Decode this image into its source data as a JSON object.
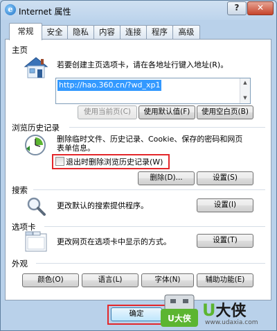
{
  "window": {
    "title": "Internet 属性",
    "help_label": "?",
    "close_label": "✕",
    "app_icon_letter": "e"
  },
  "tabs": [
    {
      "label": "常规",
      "active": true
    },
    {
      "label": "安全"
    },
    {
      "label": "隐私"
    },
    {
      "label": "内容"
    },
    {
      "label": "连接"
    },
    {
      "label": "程序"
    },
    {
      "label": "高级"
    }
  ],
  "homepage": {
    "section_label": "主页",
    "description": "若要创建主页选项卡，请在各地址行键入地址(R)。",
    "url_value": "http://hao.360.cn/?wd_xp1",
    "buttons": {
      "use_current": "使用当前页(C)",
      "use_default": "使用默认值(F)",
      "use_blank": "使用空白页(B)"
    }
  },
  "history": {
    "section_label": "浏览历史记录",
    "description_line1": "删除临时文件、历史记录、Cookie、保存的密码和网页",
    "description_line2": "表单信息。",
    "checkbox_label": "退出时删除浏览历史记录(W)",
    "checkbox_checked": false,
    "delete_button": "删除(D)...",
    "settings_button": "设置(S)"
  },
  "search": {
    "section_label": "搜索",
    "description": "更改默认的搜索提供程序。",
    "settings_button": "设置(I)"
  },
  "tabs_section": {
    "section_label": "选项卡",
    "description": "更改网页在选项卡中显示的方式。",
    "settings_button": "设置(T)"
  },
  "appearance": {
    "section_label": "外观",
    "buttons": {
      "colors": "颜色(O)",
      "languages": "语言(L)",
      "fonts": "字体(N)",
      "accessibility": "辅助功能(E)"
    }
  },
  "footer": {
    "ok_button": "确定"
  },
  "watermark": {
    "badge_text": "U大侠",
    "brand_u": "U",
    "brand_text": "大侠",
    "url": "www.udaxia.com"
  },
  "colors": {
    "highlight": "#e3262a",
    "link_blue": "#0066cc",
    "brand_green": "#5cb531"
  }
}
